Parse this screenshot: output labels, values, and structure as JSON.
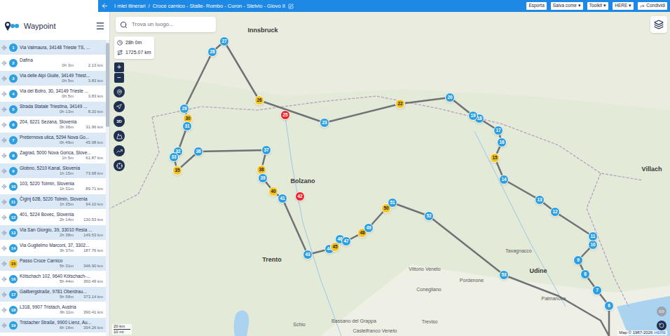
{
  "topbar": {
    "breadcrumb": [
      "I miei itinerari",
      "Croce carnico - Stalle- Rombo - Curon - Stelvio - Giovo II"
    ],
    "separator": "/",
    "buttons": [
      {
        "label": "Esporta",
        "caret": ""
      },
      {
        "label": "Salva come",
        "caret": "▾"
      },
      {
        "label": "Toolkit",
        "caret": "▾"
      },
      {
        "label": "HERE",
        "caret": "▾"
      }
    ],
    "share": "Condividi"
  },
  "sidebar": {
    "title": "Waypoint",
    "waypoints": [
      {
        "number": "1",
        "name": "Via Valmaura, 34148 Trieste TS, ...",
        "time": "",
        "distance": "",
        "color": "#2d9fdf"
      },
      {
        "number": "2",
        "name": "Dafina",
        "time": "0h 3m",
        "distance": "2.13 km",
        "color": "#2d9fdf"
      },
      {
        "number": "3",
        "name": "Via delle Alpi Giulie, 34149 Triest...",
        "time": "0h 5m",
        "distance": "3.83 km",
        "color": "#2d9fdf"
      },
      {
        "number": "4",
        "name": "Via del Botro, 30, 34149 Trieste ...",
        "time": "0h 5m",
        "distance": "3.83 km",
        "color": "#2d9fdf"
      },
      {
        "number": "5",
        "name": "Strada Statale Triestina, 34149 ...",
        "time": "0h 13m",
        "distance": "8.20 km",
        "color": "#2d9fdf"
      },
      {
        "number": "6",
        "name": "204, 6221 Sezana, Slovenia",
        "time": "0h 36m",
        "distance": "31.96 km",
        "color": "#2d9fdf"
      },
      {
        "number": "7",
        "name": "Prešernova ulica, 5294 Nova Go...",
        "time": "0h 49m",
        "distance": "45.98 km",
        "color": "#2d9fdf"
      },
      {
        "number": "8",
        "name": "Zagrad, 5000 Nova Gorica, Slove...",
        "time": "1h 5m",
        "distance": "61.87 km",
        "color": "#2d9fdf"
      },
      {
        "number": "9",
        "name": "Globno, 5210 Kanal, Slovenia",
        "time": "1h 15m",
        "distance": "73.68 km",
        "color": "#2d9fdf"
      },
      {
        "number": "10",
        "name": "103, 5220 Tolmin, Slovenia",
        "time": "1h 31m",
        "distance": "89.71 km",
        "color": "#2d9fdf"
      },
      {
        "number": "11",
        "name": "Čiginj 62B, 5220 Tolmin, Slovenia",
        "time": "1h 35m",
        "distance": "94.10 km",
        "color": "#2d9fdf"
      },
      {
        "number": "12",
        "name": "401, 5224 Bovec, Slovenia",
        "time": "2h 14m",
        "distance": "130.53 km",
        "color": "#2d9fdf"
      },
      {
        "number": "13",
        "name": "Via San Giorgio, 39, 33010 Resia ...",
        "time": "2h 38m",
        "distance": "149.53 km",
        "color": "#2d9fdf"
      },
      {
        "number": "14",
        "name": "Via Guglielmo Marconi, 37, 3302...",
        "time": "3h 37m",
        "distance": "187.76 km",
        "color": "#2d9fdf"
      },
      {
        "number": "15",
        "name": "Passo Croce Carnico",
        "time": "5h 31m",
        "distance": "346.90 km",
        "color": "#f6c21c"
      },
      {
        "number": "16",
        "name": "Kötschach 102, 9640 Kötschach-...",
        "time": "5h 44m",
        "distance": "360.49 km",
        "color": "#2d9fdf"
      },
      {
        "number": "17",
        "name": "Gailbergstraße, 9781 Oberdrau...",
        "time": "5h 58m",
        "distance": "373.14 km",
        "color": "#2d9fdf"
      },
      {
        "number": "18",
        "name": "L318, 9907 Tristach, Austria",
        "time": "6h 11m",
        "distance": "390.41 km",
        "color": "#2d9fdf"
      },
      {
        "number": "19",
        "name": "Tristacher Straße, 9900 Lienz, Au...",
        "time": "6h 16m",
        "distance": "394.26 km",
        "color": "#2d9fdf"
      }
    ]
  },
  "map": {
    "search_placeholder": "Trova un luogo...",
    "duration": "28h 0m",
    "distance": "1725.07 km",
    "zoom_in": "+",
    "zoom_out": "−",
    "three_d": "3D",
    "scale_km": "20 km",
    "scale_mi": "10 mi",
    "attribution": "Map © 1987-2026",
    "attribution_link": "HERE",
    "markers": [
      {
        "label": "6",
        "color": "#2d9fdf"
      },
      {
        "label": "7",
        "color": "#2d9fdf"
      },
      {
        "label": "8",
        "color": "#2d9fdf"
      },
      {
        "label": "9",
        "color": "#2d9fdf"
      },
      {
        "label": "10",
        "color": "#2d9fdf"
      },
      {
        "label": "11",
        "color": "#2d9fdf"
      },
      {
        "label": "12",
        "color": "#2d9fdf"
      },
      {
        "label": "13",
        "color": "#2d9fdf"
      },
      {
        "label": "14",
        "color": "#2d9fdf"
      },
      {
        "label": "15",
        "color": "#f6c21c"
      },
      {
        "label": "16",
        "color": "#2d9fdf"
      },
      {
        "label": "17",
        "color": "#2d9fdf"
      },
      {
        "label": "18",
        "color": "#2d9fdf"
      },
      {
        "label": "19",
        "color": "#2d9fdf"
      },
      {
        "label": "20",
        "color": "#2d9fdf"
      },
      {
        "label": "22",
        "color": "#f6c21c"
      },
      {
        "label": "23",
        "color": "#2d9fdf"
      },
      {
        "label": "25",
        "color": "#e8262b"
      },
      {
        "label": "26",
        "color": "#f6c21c"
      },
      {
        "label": "27",
        "color": "#2d9fdf"
      },
      {
        "label": "28",
        "color": "#2d9fdf"
      },
      {
        "label": "29",
        "color": "#2d9fdf"
      },
      {
        "label": "30",
        "color": "#f6c21c"
      },
      {
        "label": "31",
        "color": "#2d9fdf"
      },
      {
        "label": "32",
        "color": "#2d9fdf"
      },
      {
        "label": "33",
        "color": "#2d9fdf"
      },
      {
        "label": "35",
        "color": "#f6c21c"
      },
      {
        "label": "36",
        "color": "#2d9fdf"
      },
      {
        "label": "37",
        "color": "#2d9fdf"
      },
      {
        "label": "38",
        "color": "#f6c21c"
      },
      {
        "label": "39",
        "color": "#2d9fdf"
      },
      {
        "label": "40",
        "color": "#f6c21c"
      },
      {
        "label": "41",
        "color": "#2d9fdf"
      },
      {
        "label": "42",
        "color": "#e8262b"
      },
      {
        "label": "43",
        "color": "#2d9fdf"
      },
      {
        "label": "44",
        "color": "#2d9fdf"
      },
      {
        "label": "45",
        "color": "#f6c21c"
      },
      {
        "label": "46",
        "color": "#2d9fdf"
      },
      {
        "label": "47",
        "color": "#2d9fdf"
      },
      {
        "label": "48",
        "color": "#f6c21c"
      },
      {
        "label": "49",
        "color": "#2d9fdf"
      },
      {
        "label": "50",
        "color": "#f6c21c"
      },
      {
        "label": "51",
        "color": "#2d9fdf"
      },
      {
        "label": "52",
        "color": "#2d9fdf"
      },
      {
        "label": "53",
        "color": "#2d9fdf"
      }
    ],
    "places": [
      {
        "name": "Innsbruck",
        "major": true
      },
      {
        "name": "Bolzano",
        "major": true
      },
      {
        "name": "Trento",
        "major": true
      },
      {
        "name": "Udine",
        "major": true
      },
      {
        "name": "Villach",
        "major": true
      },
      {
        "name": "Pordenone",
        "major": false
      },
      {
        "name": "Conegliano",
        "major": false
      },
      {
        "name": "Vittorio Veneto",
        "major": false
      },
      {
        "name": "Treviso",
        "major": false
      },
      {
        "name": "Castelfranco Veneto",
        "major": false
      },
      {
        "name": "Bassano del Grappa",
        "major": false
      },
      {
        "name": "Schio",
        "major": false
      },
      {
        "name": "Tavagnacco",
        "major": false
      },
      {
        "name": "Palmanova",
        "major": false
      }
    ]
  }
}
